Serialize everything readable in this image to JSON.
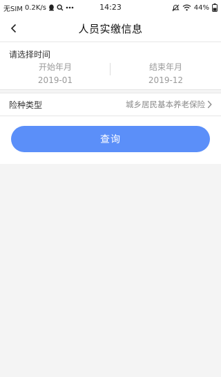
{
  "status_bar": {
    "carrier": "无SIM",
    "speed": "0.2K/s",
    "time": "14:23",
    "battery": "44%",
    "icons": [
      "qq-icon",
      "search-icon",
      "more-icon",
      "mute-icon",
      "wifi-icon",
      "battery-icon"
    ]
  },
  "header": {
    "title": "人员实缴信息",
    "back_icon": "chevron-left-icon"
  },
  "filter": {
    "section_label": "请选择时间",
    "start": {
      "caption": "开始年月",
      "value": "2019-01"
    },
    "end": {
      "caption": "结束年月",
      "value": "2019-12"
    },
    "insurance_type_label": "险种类型",
    "insurance_type_value": "城乡居民基本养老保险"
  },
  "actions": {
    "query_label": "查询"
  },
  "colors": {
    "accent": "#5b8ff9",
    "background": "#f4f4f4"
  }
}
